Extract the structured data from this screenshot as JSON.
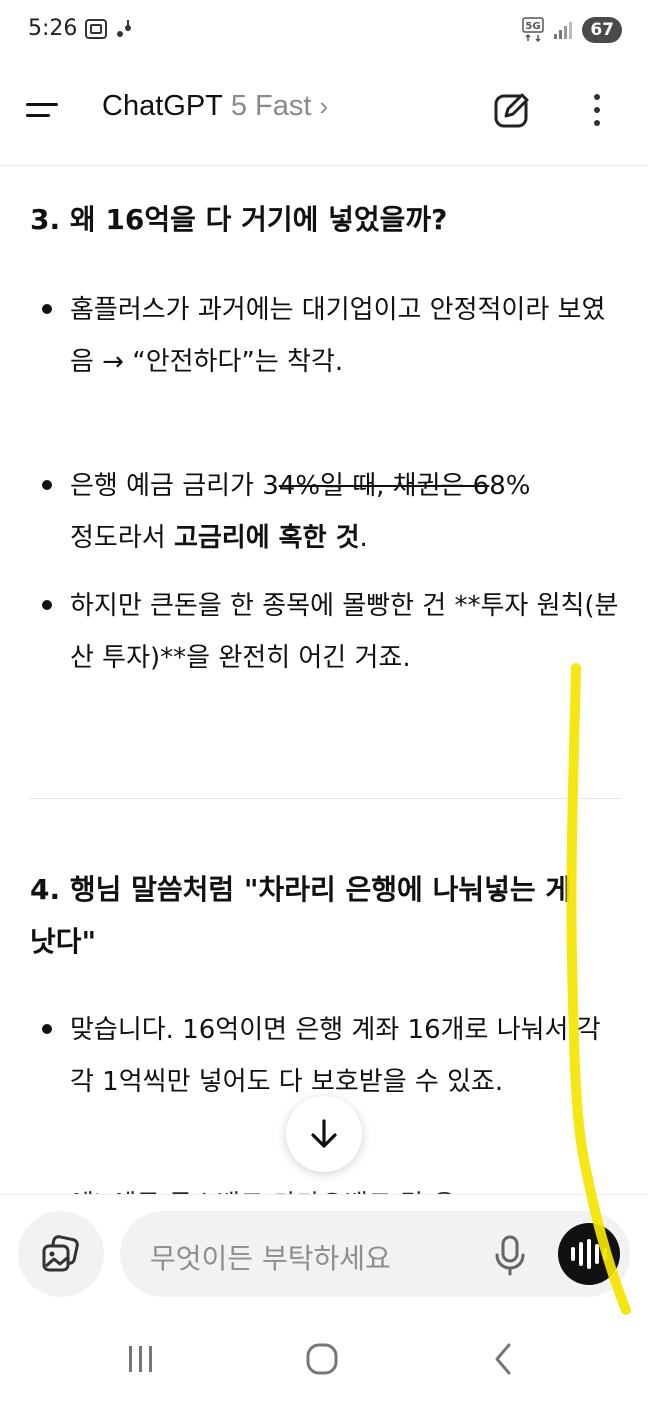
{
  "status_bar": {
    "time": "5:26",
    "network": "5G",
    "battery": "67"
  },
  "header": {
    "app_name": "ChatGPT",
    "model": "5 Fast",
    "chevron": "›"
  },
  "content": {
    "section3": {
      "heading": "3. 왜 16억을 다 거기에 넣었을까?",
      "bullets": [
        {
          "text": "홈플러스가 과거에는 대기업이고 안정적이라 보였음 → “안전하다”는 착각."
        },
        {
          "prefix": "은행 예금 금리가 3",
          "strike": "4%일 때, 채권은 6",
          "suffix": "8%",
          "line2_normal": "정도라서 ",
          "line2_bold": "고금리에 혹한 것",
          "line2_end": "."
        },
        {
          "text": "하지만 큰돈을 한 종목에 몰빵한 건 **투자 원칙(분산 투자)**을 완전히 어긴 거죠."
        }
      ]
    },
    "section4": {
      "heading": "4. 행님 말씀처럼 \"차라리 은행에 나눠넣는 게 낫다\"",
      "bullets": [
        {
          "text": "맞습니다. 16억이면 은행 계좌 16개로 나눠서 각각 1억씩만 넣어도 다 보호받을 수 있죠."
        }
      ],
      "partial_line": "예) 예금  투스뱅크  카카오뱅크  각 은"
    }
  },
  "composer": {
    "placeholder": "무엇이든 부탁하세요"
  },
  "icons": {
    "menu": "menu-icon",
    "new_chat": "edit-icon",
    "more": "more-vertical-icon",
    "scroll_down": "arrow-down-icon",
    "attach": "image-attach-icon",
    "mic": "mic-icon",
    "voice": "voice-wave-icon"
  },
  "colors": {
    "annotation": "#f5e400",
    "muted": "#8a8a8a"
  }
}
